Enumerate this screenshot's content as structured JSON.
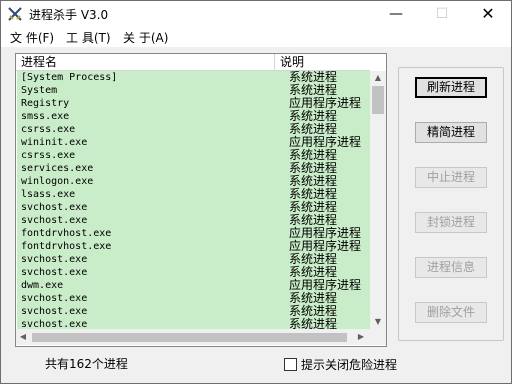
{
  "window": {
    "title": "进程杀手 V3.0",
    "caption": {
      "minimize": "—",
      "maximize": "☐",
      "close": "✕"
    }
  },
  "menu": [
    {
      "label": "文 件(F)"
    },
    {
      "label": "工 具(T)"
    },
    {
      "label": "关 于(A)"
    }
  ],
  "list": {
    "columns": {
      "name": "进程名",
      "desc": "说明"
    },
    "rows": [
      {
        "name": "[System Process]",
        "desc": "系统进程"
      },
      {
        "name": "System",
        "desc": "系统进程"
      },
      {
        "name": "Registry",
        "desc": "应用程序进程"
      },
      {
        "name": "smss.exe",
        "desc": "系统进程"
      },
      {
        "name": "csrss.exe",
        "desc": "系统进程"
      },
      {
        "name": "wininit.exe",
        "desc": "应用程序进程"
      },
      {
        "name": "csrss.exe",
        "desc": "系统进程"
      },
      {
        "name": "services.exe",
        "desc": "系统进程"
      },
      {
        "name": "winlogon.exe",
        "desc": "系统进程"
      },
      {
        "name": "lsass.exe",
        "desc": "系统进程"
      },
      {
        "name": "svchost.exe",
        "desc": "系统进程"
      },
      {
        "name": "svchost.exe",
        "desc": "系统进程"
      },
      {
        "name": "fontdrvhost.exe",
        "desc": "应用程序进程"
      },
      {
        "name": "fontdrvhost.exe",
        "desc": "应用程序进程"
      },
      {
        "name": "svchost.exe",
        "desc": "系统进程"
      },
      {
        "name": "svchost.exe",
        "desc": "系统进程"
      },
      {
        "name": "dwm.exe",
        "desc": "应用程序进程"
      },
      {
        "name": "svchost.exe",
        "desc": "系统进程"
      },
      {
        "name": "svchost.exe",
        "desc": "系统进程"
      },
      {
        "name": "svchost.exe",
        "desc": "系统进程"
      }
    ],
    "row_color": "#c9ecc9"
  },
  "buttons": [
    {
      "label": "刷新进程",
      "state": "default"
    },
    {
      "label": "精简进程",
      "state": "enabled"
    },
    {
      "label": "中止进程",
      "state": "disabled"
    },
    {
      "label": "封锁进程",
      "state": "disabled"
    },
    {
      "label": "进程信息",
      "state": "disabled"
    },
    {
      "label": "删除文件",
      "state": "disabled"
    }
  ],
  "status": {
    "count_text": "共有162个进程",
    "checkbox_label": "提示关闭危险进程",
    "checkbox_checked": false
  }
}
